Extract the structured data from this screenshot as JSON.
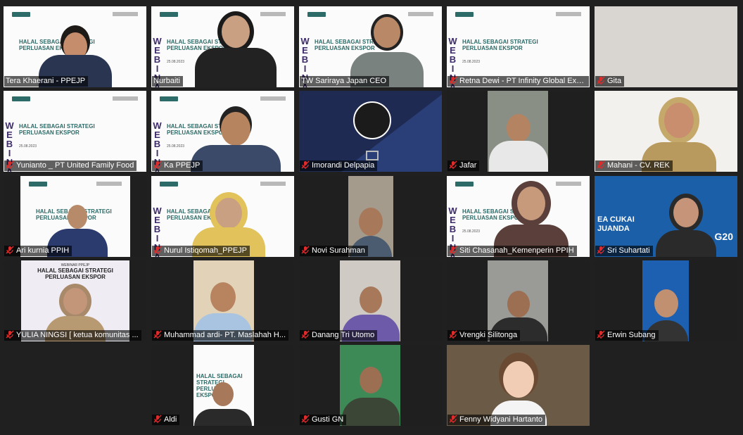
{
  "meeting": {
    "slide": {
      "vertical_text": "WEBINAR",
      "title": "HALAL SEBAGAI STRATEGI PERLUASAN EKSPOR",
      "date": "25.08.2023",
      "alt_header": "WEBINAR PPEJP",
      "alt_title": "HALAL SEBAGAI STRATEGI PERLUASAN EKSPOR"
    },
    "poster_text": "EA CUKAI JUANDA",
    "poster_badge": "G20",
    "participants": [
      {
        "name": "Tera Khaerani - PPEJP",
        "muted": false
      },
      {
        "name": "Nurbaiti",
        "muted": false
      },
      {
        "name": "TW Sariraya Japan CEO",
        "muted": false
      },
      {
        "name": "Retna Dewi - PT Infinity Global Exp...",
        "muted": true
      },
      {
        "name": "Gita",
        "muted": true
      },
      {
        "name": "Yunianto _ PT United Family Food",
        "muted": true
      },
      {
        "name": "Ka PPEJP",
        "muted": true
      },
      {
        "name": "Imorandi Delpapia",
        "muted": true
      },
      {
        "name": "Jafar",
        "muted": true
      },
      {
        "name": "Mahani - CV. REK",
        "muted": true
      },
      {
        "name": "Ari kurnia PPIH",
        "muted": true
      },
      {
        "name": "Nurul Istiqomah_PPEJP",
        "muted": true
      },
      {
        "name": "Novi Surahman",
        "muted": true
      },
      {
        "name": "Siti Chasanah_Kemenperin PPIH",
        "muted": true
      },
      {
        "name": "Sri Suhartati",
        "muted": true
      },
      {
        "name": "YULIA NINGSI [ ketua komunitas ...",
        "muted": true
      },
      {
        "name": "Muhammad ardi- PT. Maslahah H...",
        "muted": true
      },
      {
        "name": "Danang Tri Utomo",
        "muted": true
      },
      {
        "name": "Vrengki Silitonga",
        "muted": true
      },
      {
        "name": "Erwin Subang",
        "muted": true
      },
      {
        "name": "Aldi",
        "muted": true
      },
      {
        "name": "Gusti GN",
        "muted": true
      },
      {
        "name": "Fenny Widyani Hartanto",
        "muted": true
      }
    ],
    "colors": {
      "background": "#202020",
      "active_border": "#d8e35a",
      "mute_icon": "#e02b2b",
      "slide_teal": "#2c6b68",
      "slide_purple": "#3d2b6a"
    }
  }
}
